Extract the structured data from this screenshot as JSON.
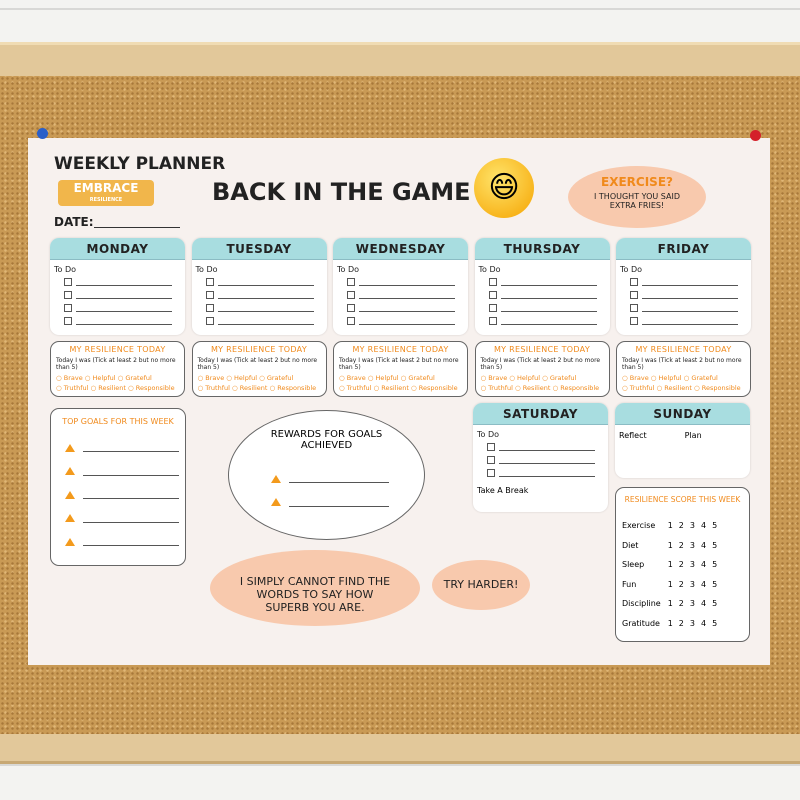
{
  "planner": {
    "heading": "WEEKLY PLANNER",
    "logo_text": "EMBRACE",
    "logo_subtext": "RESILIENCE",
    "main_title": "BACK IN THE GAME",
    "date_label": "DATE:",
    "todo_label": "To Do",
    "days": [
      {
        "name": "MONDAY"
      },
      {
        "name": "TUESDAY"
      },
      {
        "name": "WEDNESDAY"
      },
      {
        "name": "THURSDAY"
      },
      {
        "name": "FRIDAY"
      }
    ],
    "resilience": {
      "title": "MY RESILIENCE TODAY",
      "instruction": "Today I was (Tick at least 2 but no more than 5)",
      "options_row1": "○ Brave   ○ Helpful  ○ Grateful",
      "options_row2": "○ Truthful ○ Resilient ○ Responsible"
    },
    "goals": {
      "title": "TOP GOALS FOR THIS WEEK"
    },
    "rewards": {
      "title": "REWARDS FOR GOALS ACHIEVED"
    },
    "saturday": {
      "name": "SATURDAY",
      "todo": "To Do",
      "extra": "Take A Break"
    },
    "sunday": {
      "name": "SUNDAY",
      "reflect": "Reflect",
      "plan": "Plan"
    },
    "score": {
      "title": "RESILIENCE SCORE THIS WEEK",
      "scale": [
        "1",
        "2",
        "3",
        "4",
        "5"
      ],
      "rows": [
        "Exercise",
        "Diet",
        "Sleep",
        "Fun",
        "Discipline",
        "Gratitude"
      ]
    },
    "bubbles": {
      "exercise_title": "EXERCISE?",
      "exercise_text": "I THOUGHT YOU SAID EXTRA FRIES!",
      "superb": "I SIMPLY CANNOT FIND THE WORDS TO SAY HOW SUPERB YOU ARE.",
      "try_harder": "TRY HARDER!"
    },
    "colors": {
      "header": "#a8dde0",
      "accent": "#f08a1c",
      "bubble": "#f8c9ad"
    }
  }
}
